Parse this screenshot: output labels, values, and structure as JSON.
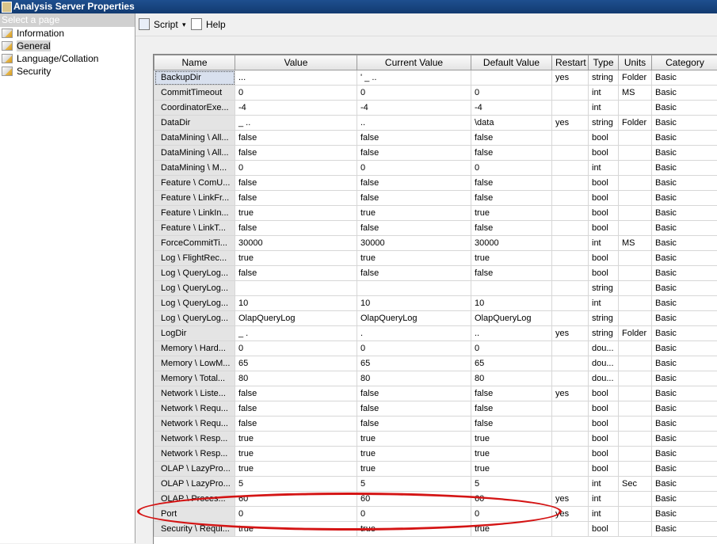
{
  "window": {
    "title": "Analysis Server Properties"
  },
  "left_pane": {
    "header": "Select a page",
    "pages": [
      {
        "label": "Information",
        "selected": false
      },
      {
        "label": "General",
        "selected": true
      },
      {
        "label": "Language/Collation",
        "selected": false
      },
      {
        "label": "Security",
        "selected": false
      }
    ]
  },
  "toolbar": {
    "script_label": "Script",
    "help_label": "Help"
  },
  "grid": {
    "columns": [
      "Name",
      "Value",
      "Current Value",
      "Default Value",
      "Restart",
      "Type",
      "Units",
      "Category"
    ],
    "rows": [
      [
        "BackupDir",
        "...",
        "' _ ..",
        "",
        "yes",
        "string",
        "Folder",
        "Basic"
      ],
      [
        "CommitTimeout",
        "0",
        "0",
        "0",
        "",
        "int",
        "MS",
        "Basic"
      ],
      [
        "CoordinatorExe...",
        "-4",
        "-4",
        "-4",
        "",
        "int",
        "",
        "Basic"
      ],
      [
        "DataDir",
        "_ ..",
        "..",
        "\\data",
        "yes",
        "string",
        "Folder",
        "Basic"
      ],
      [
        "DataMining \\ All...",
        "false",
        "false",
        "false",
        "",
        "bool",
        "",
        "Basic"
      ],
      [
        "DataMining \\ All...",
        "false",
        "false",
        "false",
        "",
        "bool",
        "",
        "Basic"
      ],
      [
        "DataMining \\ M...",
        "0",
        "0",
        "0",
        "",
        "int",
        "",
        "Basic"
      ],
      [
        "Feature \\ ComU...",
        "false",
        "false",
        "false",
        "",
        "bool",
        "",
        "Basic"
      ],
      [
        "Feature \\ LinkFr...",
        "false",
        "false",
        "false",
        "",
        "bool",
        "",
        "Basic"
      ],
      [
        "Feature \\ LinkIn...",
        "true",
        "true",
        "true",
        "",
        "bool",
        "",
        "Basic"
      ],
      [
        "Feature \\ LinkT...",
        "false",
        "false",
        "false",
        "",
        "bool",
        "",
        "Basic"
      ],
      [
        "ForceCommitTi...",
        "30000",
        "30000",
        "30000",
        "",
        "int",
        "MS",
        "Basic"
      ],
      [
        "Log \\ FlightRec...",
        "true",
        "true",
        "true",
        "",
        "bool",
        "",
        "Basic"
      ],
      [
        "Log \\ QueryLog...",
        "false",
        "false",
        "false",
        "",
        "bool",
        "",
        "Basic"
      ],
      [
        "Log \\ QueryLog...",
        "",
        "",
        "",
        "",
        "string",
        "",
        "Basic"
      ],
      [
        "Log \\ QueryLog...",
        "10",
        "10",
        "10",
        "",
        "int",
        "",
        "Basic"
      ],
      [
        "Log \\ QueryLog...",
        "OlapQueryLog",
        "OlapQueryLog",
        "OlapQueryLog",
        "",
        "string",
        "",
        "Basic"
      ],
      [
        "LogDir",
        "_ .",
        ".",
        "..",
        "yes",
        "string",
        "Folder",
        "Basic"
      ],
      [
        "Memory \\ Hard...",
        "0",
        "0",
        "0",
        "",
        "dou...",
        "",
        "Basic"
      ],
      [
        "Memory \\ LowM...",
        "65",
        "65",
        "65",
        "",
        "dou...",
        "",
        "Basic"
      ],
      [
        "Memory \\ Total...",
        "80",
        "80",
        "80",
        "",
        "dou...",
        "",
        "Basic"
      ],
      [
        "Network \\ Liste...",
        "false",
        "false",
        "false",
        "yes",
        "bool",
        "",
        "Basic"
      ],
      [
        "Network \\ Requ...",
        "false",
        "false",
        "false",
        "",
        "bool",
        "",
        "Basic"
      ],
      [
        "Network \\ Requ...",
        "false",
        "false",
        "false",
        "",
        "bool",
        "",
        "Basic"
      ],
      [
        "Network \\ Resp...",
        "true",
        "true",
        "true",
        "",
        "bool",
        "",
        "Basic"
      ],
      [
        "Network \\ Resp...",
        "true",
        "true",
        "true",
        "",
        "bool",
        "",
        "Basic"
      ],
      [
        "OLAP \\ LazyPro...",
        "true",
        "true",
        "true",
        "",
        "bool",
        "",
        "Basic"
      ],
      [
        "OLAP \\ LazyPro...",
        "5",
        "5",
        "5",
        "",
        "int",
        "Sec",
        "Basic"
      ],
      [
        "OLAP \\ Proces...",
        "60",
        "60",
        "60",
        "yes",
        "int",
        "",
        "Basic"
      ],
      [
        "Port",
        "0",
        "0",
        "0",
        "yes",
        "int",
        "",
        "Basic"
      ],
      [
        "Security \\ Requi...",
        "true",
        "true",
        "true",
        "",
        "bool",
        "",
        "Basic"
      ]
    ]
  },
  "annotation_color": "#d41414"
}
